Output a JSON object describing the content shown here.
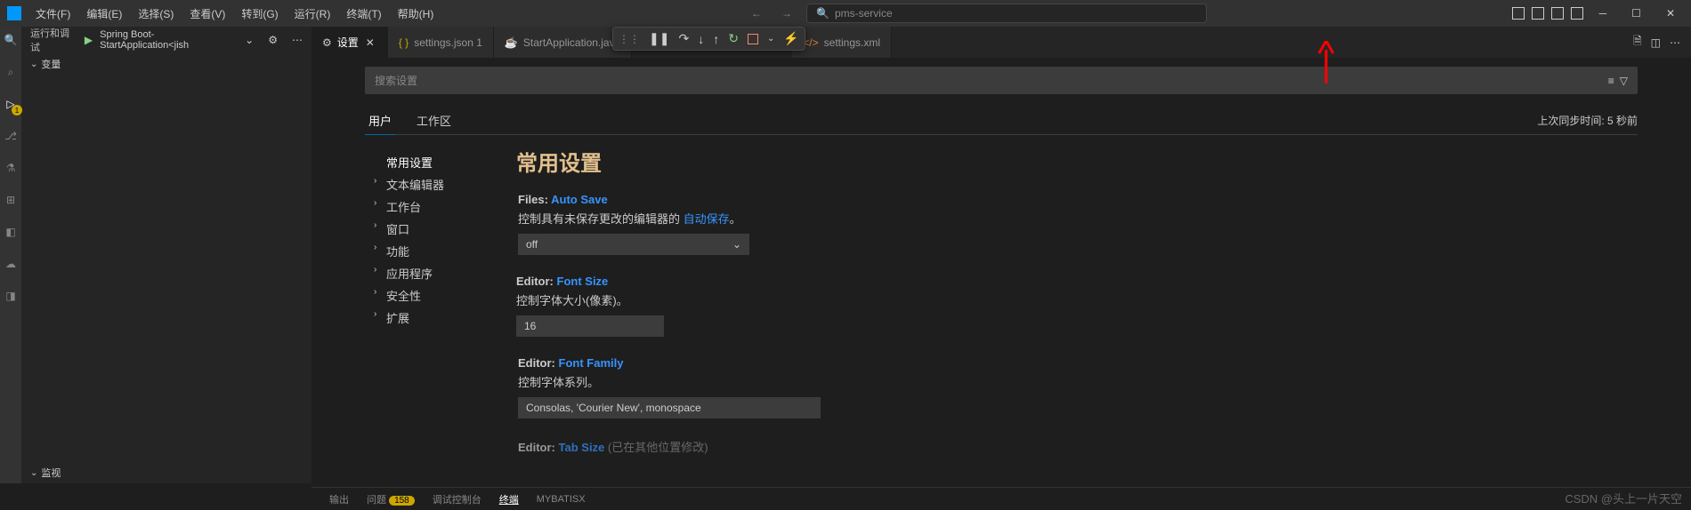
{
  "menubar": [
    "文件(F)",
    "编辑(E)",
    "选择(S)",
    "查看(V)",
    "转到(G)",
    "运行(R)",
    "终端(T)",
    "帮助(H)"
  ],
  "titleSearch": {
    "text": "pms-service"
  },
  "sidebar": {
    "header": "运行和调试",
    "config": "Spring Boot-StartApplication<jish",
    "sections": [
      "变量",
      "监视"
    ]
  },
  "activityBadge": "1",
  "tabs": [
    {
      "label": "设置",
      "type": "gear",
      "active": true,
      "close": true
    },
    {
      "label": "settings.json 1",
      "type": "json",
      "modified": true
    },
    {
      "label": "StartApplication.java",
      "type": "java"
    },
    {
      "label": "settings.xml",
      "type": "xml"
    }
  ],
  "settings": {
    "searchPlaceholder": "搜索设置",
    "scopes": {
      "user": "用户",
      "workspace": "工作区"
    },
    "syncInfo": "上次同步时间: 5 秒前",
    "toc": [
      "常用设置",
      "文本编辑器",
      "工作台",
      "窗口",
      "功能",
      "应用程序",
      "安全性",
      "扩展"
    ],
    "heading": "常用设置",
    "items": {
      "autoSave": {
        "labelKey": "Files:",
        "labelProp": "Auto Save",
        "desc1": "控制具有未保存更改的编辑器的 ",
        "descLink": "自动保存",
        "desc2": "。",
        "value": "off"
      },
      "fontSize": {
        "labelKey": "Editor:",
        "labelProp": "Font Size",
        "desc": "控制字体大小(像素)。",
        "value": "16"
      },
      "fontFamily": {
        "labelKey": "Editor:",
        "labelProp": "Font Family",
        "desc": "控制字体系列。",
        "value": "Consolas, 'Courier New', monospace"
      },
      "tabSize": {
        "labelKey": "Editor:",
        "labelProp": "Tab Size",
        "descPartial": "(已在其他位置修改)"
      }
    }
  },
  "panel": {
    "tabs": [
      "输出",
      "问题",
      "调试控制台",
      "终端",
      "MYBATISX"
    ],
    "problemCount": "158"
  },
  "watermark": "CSDN @头上一片天空"
}
